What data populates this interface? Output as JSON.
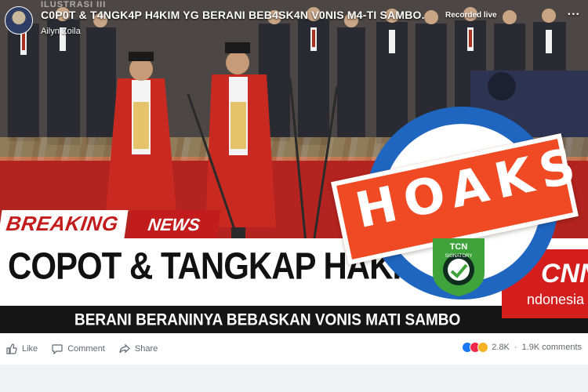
{
  "post": {
    "title": "C0P0T & T4NGK4P H4KIM YG BERANI BEB4SK4N V0NIS M4-TI SAMBO.",
    "watermark": "ILUSTRASI III",
    "author": "Ailyn Zoila",
    "live_label": "Recorded live",
    "more_label": "..."
  },
  "video_overlay": {
    "breaking": "BREAKING",
    "news": "NEWS",
    "headline": "COPOT & TANGKAP HAKIM",
    "subheadline": "BERANI BERANINYA BEBASKAN VONIS MATI SAMBO",
    "channel_logo": "CNN",
    "channel_sub": "ndonesia"
  },
  "stamp": {
    "word": "HOAKS",
    "badge_text": "TCN",
    "badge_sub": "SIGNATORY",
    "colors": {
      "stamp_orange": "#ef4a23",
      "ring_blue": "#1f66c1",
      "badge_green": "#3da33a"
    }
  },
  "actions": {
    "like_label": "Like",
    "comment_label": "Comment",
    "share_label": "Share",
    "reaction_count": "2.8K",
    "separator": "·",
    "comment_count": "1.9K comments"
  },
  "colors": {
    "breaking_red": "#c31c1c",
    "fb_gray": "#606770"
  }
}
